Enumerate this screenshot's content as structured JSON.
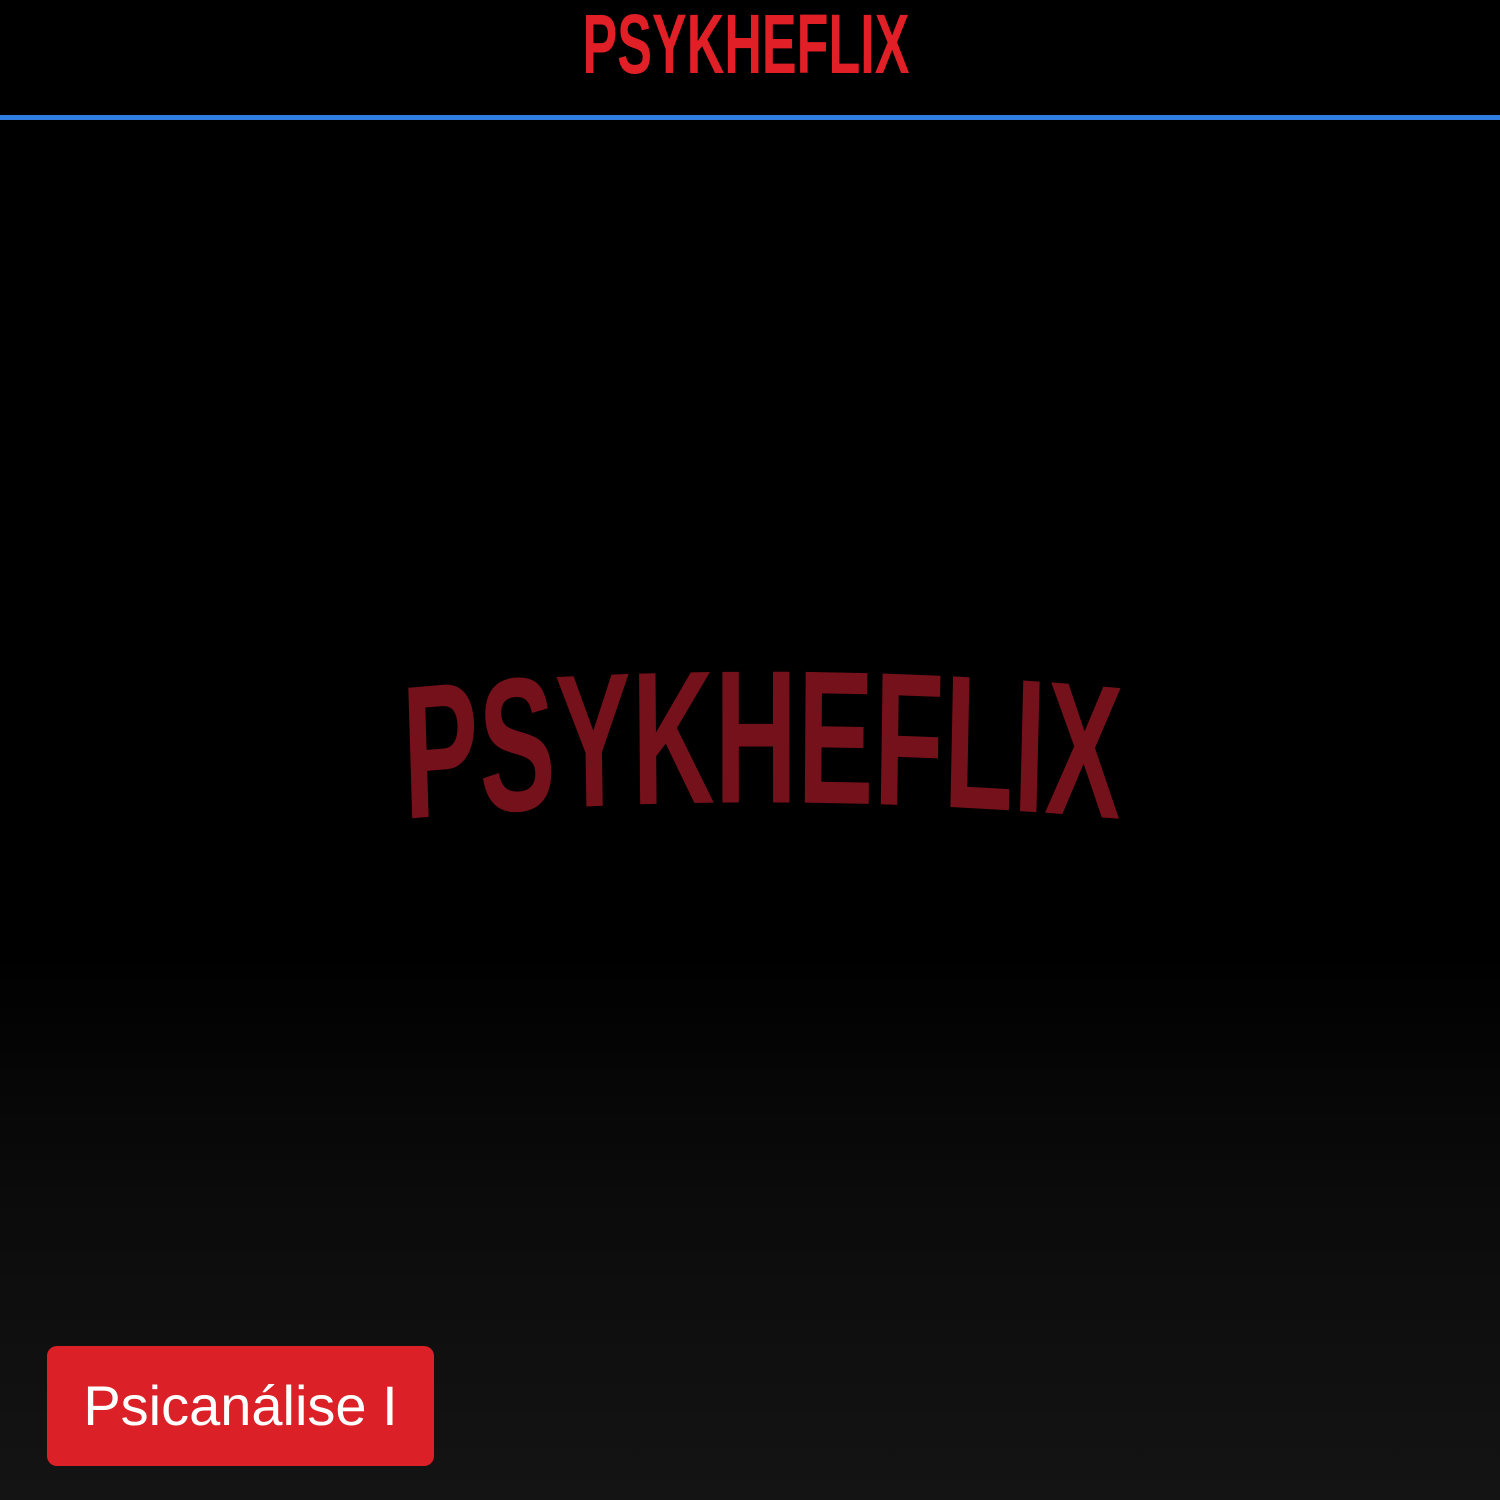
{
  "header": {
    "logo_text": "PSYKHEFLIX"
  },
  "hero": {
    "logo_text": "PSYKHEFLIX"
  },
  "course_button": {
    "label": "Psicanálise I"
  },
  "colors": {
    "background": "#000000",
    "header_logo": "#e01f26",
    "hero_logo": "#74111a",
    "divider": "#2f7de1",
    "button": "#dc2028",
    "button_text": "#ffffff"
  }
}
